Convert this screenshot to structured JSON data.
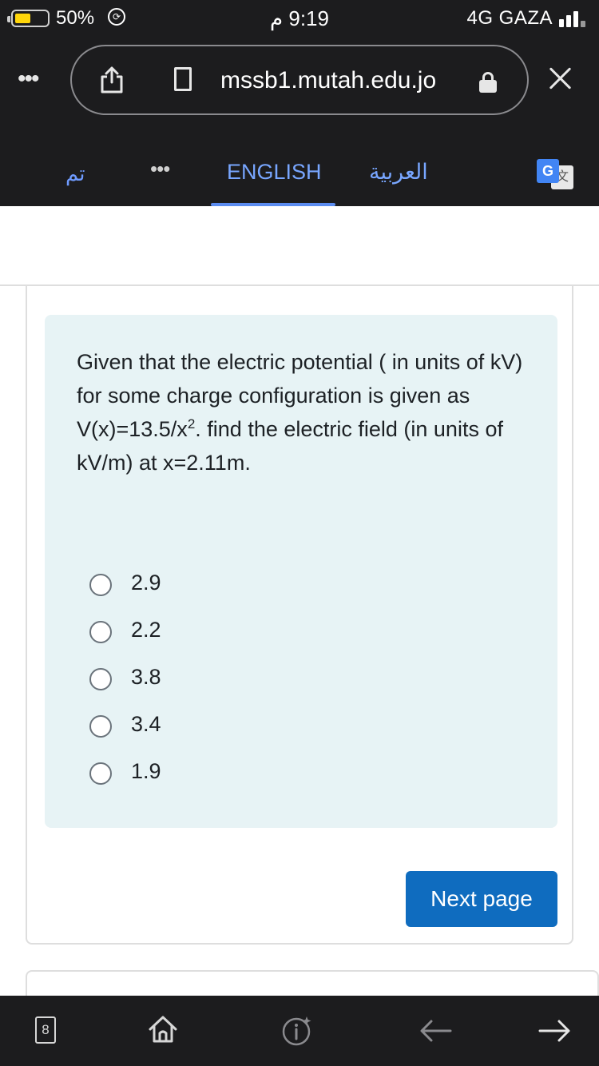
{
  "status_bar": {
    "battery_percent": "50%",
    "battery_level": 0.5,
    "time": "9:19 م",
    "network": "4G  GAZA",
    "signal_bars": 3
  },
  "browser": {
    "url": "mssb1.mutah.edu.jo",
    "icons": {
      "menu": "dots-menu-icon",
      "share": "share-icon",
      "bookmark": "bookmark-icon",
      "lock": "lock-icon",
      "close": "close-icon"
    }
  },
  "translate_bar": {
    "done_label": "تم",
    "menu_label": "•••",
    "lang_english": "ENGLISH",
    "lang_arabic": "العربية",
    "active_language": "ENGLISH",
    "translate_icon_letter": "G",
    "translate_icon_glyph": "文"
  },
  "question": {
    "text_part1": "Given that the electric potential ( in units of kV) for some charge configuration is given as V(x)=13.5/x",
    "text_sup": "2",
    "text_part2": ". find the electric field (in units of kV/m) at x=2.11m.",
    "options": [
      {
        "label": "2.9",
        "selected": false
      },
      {
        "label": "2.2",
        "selected": false
      },
      {
        "label": "3.8",
        "selected": false
      },
      {
        "label": "3.4",
        "selected": false
      },
      {
        "label": "1.9",
        "selected": false
      }
    ],
    "next_button": "Next page"
  },
  "bottom_bar": {
    "tab_count": "8",
    "icons": [
      "tabs-icon",
      "home-icon",
      "info-icon",
      "back-arrow-icon",
      "forward-arrow-icon"
    ]
  },
  "colors": {
    "chrome_dark": "#1c1c1e",
    "link_blue": "#78a6ff",
    "question_bg": "#e7f3f5",
    "primary_button": "#0f6cbf",
    "battery_yellow": "#ffd60a"
  }
}
